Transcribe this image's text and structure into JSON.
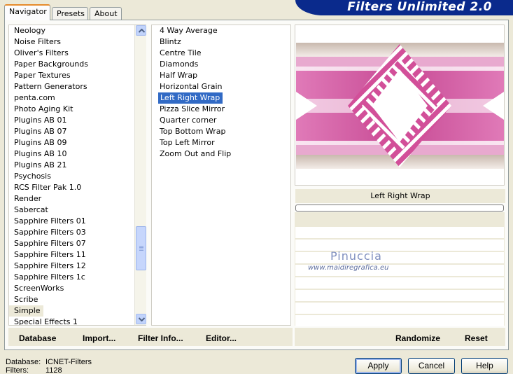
{
  "tabs": [
    {
      "label": "Navigator"
    },
    {
      "label": "Presets"
    },
    {
      "label": "About"
    }
  ],
  "banner_title": "Filters Unlimited 2.0",
  "categories": [
    "Neology",
    "Noise Filters",
    "Oliver's Filters",
    "Paper Backgrounds",
    "Paper Textures",
    "Pattern Generators",
    "penta.com",
    "Photo Aging Kit",
    "Plugins AB 01",
    "Plugins AB 07",
    "Plugins AB 09",
    "Plugins AB 10",
    "Plugins AB 21",
    "Psychosis",
    "RCS Filter Pak 1.0",
    "Render",
    "Sabercat",
    "Sapphire Filters 01",
    "Sapphire Filters 03",
    "Sapphire Filters 07",
    "Sapphire Filters 11",
    "Sapphire Filters 12",
    "Sapphire Filters 1c",
    "ScreenWorks",
    "Scribe",
    "Simple",
    "Special Effects 1"
  ],
  "selected_category": "Simple",
  "filters": [
    "4 Way Average",
    "Blintz",
    "Centre Tile",
    "Diamonds",
    "Half Wrap",
    "Horizontal Grain",
    "Left Right Wrap",
    "Pizza Slice Mirror",
    "Quarter corner",
    "Top Bottom Wrap",
    "Top Left Mirror",
    "Zoom Out and Flip"
  ],
  "selected_filter": "Left Right Wrap",
  "preview": {
    "filter_name": "Left Right Wrap",
    "colors": {
      "pink": "#d2509a",
      "light_pink": "#f0b8d8",
      "white": "#ffffff",
      "taupe": "#c7b8ad"
    }
  },
  "watermark": {
    "name": "Pinuccia",
    "url": "www.maidiregrafica.eu"
  },
  "toolbar": {
    "database": "Database",
    "import": "Import...",
    "filter_info": "Filter Info...",
    "editor": "Editor...",
    "randomize": "Randomize",
    "reset": "Reset"
  },
  "status": {
    "database_label": "Database:",
    "database_value": "ICNET-Filters",
    "filters_label": "Filters:",
    "filters_value": "1128"
  },
  "buttons": {
    "apply": "Apply",
    "cancel": "Cancel",
    "help": "Help"
  },
  "colors": {
    "banner": "#0a2a8c",
    "selection": "#316ac5",
    "face": "#ece9d8"
  }
}
